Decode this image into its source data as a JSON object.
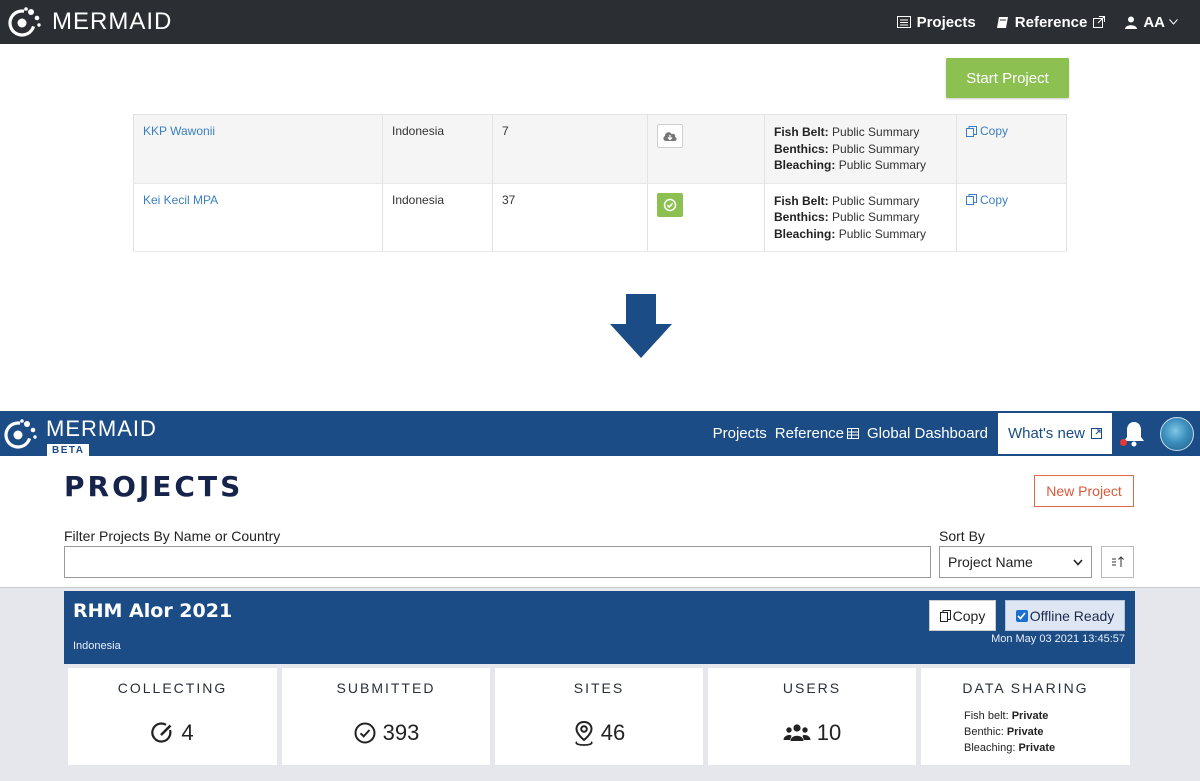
{
  "old_ui": {
    "brand": "MERMAID",
    "nav": {
      "projects": "Projects",
      "reference": "Reference",
      "user": "AA"
    },
    "start_project": "Start Project",
    "rows": [
      {
        "name": "KKP Wawonii",
        "country": "Indonesia",
        "count": "7",
        "status_icon": "cloud-download-icon",
        "summaries": [
          {
            "label": "Fish Belt:",
            "value": "Public Summary"
          },
          {
            "label": "Benthics:",
            "value": "Public Summary"
          },
          {
            "label": "Bleaching:",
            "value": "Public Summary"
          }
        ],
        "copy": "Copy"
      },
      {
        "name": "Kei Kecil MPA",
        "country": "Indonesia",
        "count": "37",
        "status_icon": "check-circle-icon",
        "summaries": [
          {
            "label": "Fish Belt:",
            "value": "Public Summary"
          },
          {
            "label": "Benthics:",
            "value": "Public Summary"
          },
          {
            "label": "Bleaching:",
            "value": "Public Summary"
          }
        ],
        "copy": "Copy"
      }
    ],
    "colors": {
      "nav_bg": "#2b2f33",
      "start_btn": "#8cc152",
      "link": "#3a7fc1"
    }
  },
  "arrow": {
    "icon": "down-arrow-icon",
    "color": "#1b4c86"
  },
  "new_ui": {
    "brand": "MERMAID",
    "badge": "BETA",
    "nav": {
      "projects": "Projects",
      "reference": "Reference",
      "global_dashboard": "Global Dashboard",
      "whats_new": "What's new"
    },
    "title": "PROJECTS",
    "new_project": "New Project",
    "filter": {
      "label": "Filter Projects By Name or Country",
      "value": "",
      "placeholder": ""
    },
    "sort": {
      "label": "Sort By",
      "selected": "Project Name"
    },
    "project": {
      "name": "RHM Alor 2021",
      "country": "Indonesia",
      "copy": "Copy",
      "offline": "Offline Ready",
      "date": "Mon May 03 2021 13:45:57"
    },
    "stats": [
      {
        "label": "COLLECTING",
        "value": "4",
        "icon": "pencil-circle-icon"
      },
      {
        "label": "SUBMITTED",
        "value": "393",
        "icon": "check-circle-icon"
      },
      {
        "label": "SITES",
        "value": "46",
        "icon": "map-pin-icon"
      },
      {
        "label": "USERS",
        "value": "10",
        "icon": "users-icon"
      }
    ],
    "sharing": {
      "label": "DATA SHARING",
      "lines": [
        {
          "label": "Fish belt:",
          "value": "Private"
        },
        {
          "label": "Benthic:",
          "value": "Private"
        },
        {
          "label": "Bleaching:",
          "value": "Private"
        }
      ]
    },
    "colors": {
      "nav_bg": "#1b4c86",
      "new_project_border": "#e06b4c",
      "cards_bg": "#e6e7ec"
    }
  }
}
